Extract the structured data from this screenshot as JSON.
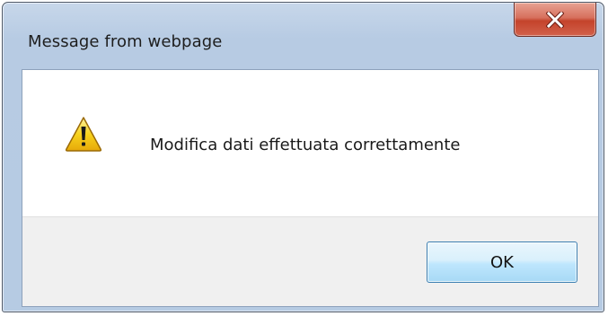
{
  "window": {
    "title": "Message from webpage",
    "close_glyph": "X",
    "close_icon": "close-icon"
  },
  "message": {
    "icon": "warning-icon",
    "text": "Modifica dati effettuata correttamente"
  },
  "buttons": {
    "ok_label": "OK"
  },
  "colors": {
    "frame": "#b7cbe3",
    "close_button": "#c4432b",
    "ok_button": "#bee6fd",
    "warning_yellow": "#f7d21c"
  }
}
